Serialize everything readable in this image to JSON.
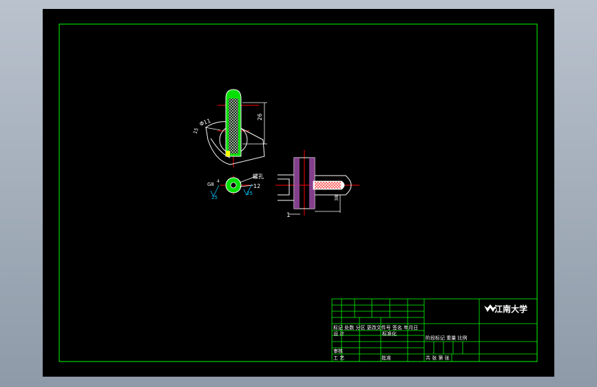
{
  "viewport": {
    "background": "#000000",
    "frame_color": "#00ff00",
    "title_block_color": "#00ff00",
    "text_color": "#ffffff",
    "centerline_color": "#ff0000",
    "dimension_color": "#ffffff",
    "roughness_color": "#00c8ff",
    "hatch_color": "#9b4aa3"
  },
  "view_left": {
    "dim_height": "26",
    "dim_hole": "Φ11",
    "dim_angle": "15"
  },
  "view_section": {
    "label_left": "G8",
    "label_hole": "4",
    "label_thread": "螺孔",
    "label_count": "12",
    "roughness_left": "25",
    "roughness_right": "25"
  },
  "view_right": {
    "part_number": "1",
    "dim_depth": "38"
  },
  "title_block": {
    "school": "江南大学",
    "row_header": "标记 处数 分区 更改文件号 签名 年月日",
    "design_label": "设 计",
    "standardize_label": "标准化",
    "stage_label": "阶段标记 重量 比例",
    "review_label": "审核",
    "process_label": "工 艺",
    "approve_label": "批准",
    "sheets_label": "共 张 第 张"
  }
}
